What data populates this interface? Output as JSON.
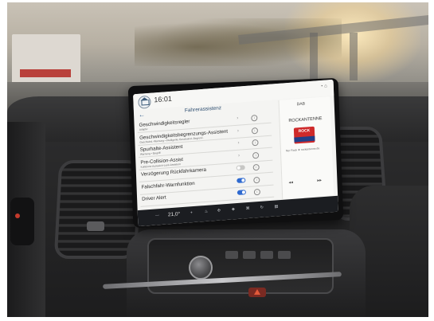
{
  "screen": {
    "time": "16:01",
    "title": "Fahrerassistenz",
    "back_symbol": "←",
    "rows": [
      {
        "label": "Geschwindigkeitsregler",
        "sub": "Adaptiv",
        "control": "chevron"
      },
      {
        "label": "Geschwindigkeitsbegrenzungs-Assistent",
        "sub": "Geschwind.-Warnung • Intelligente Geschwind.-Begrenz.",
        "control": "chevron"
      },
      {
        "label": "Spurhalte-Assistent",
        "sub": "Warnung • Eingriff",
        "control": "chevron"
      },
      {
        "label": "Pre-Collision-Assist",
        "sub": "Kollisions-Ausweich-Lenk-Assistent",
        "control": "chevron"
      },
      {
        "label": "Verzögerung Rückfahrkamera",
        "sub": "",
        "control": "toggle",
        "on": false
      },
      {
        "label": "Falschfahr-Warnfunktion",
        "sub": "",
        "control": "toggle",
        "on": true
      },
      {
        "label": "Driver Alert",
        "sub": "",
        "control": "toggle",
        "on": true
      }
    ],
    "info_symbol": "i",
    "chevron_symbol": "›",
    "radio": {
      "source": "DAB",
      "station": "ROCKANTENNE",
      "logo_text": "ROCK",
      "meta": "Nur Rock ★ rockantenne.de"
    },
    "bottombar": {
      "temp": "21,0°"
    }
  }
}
